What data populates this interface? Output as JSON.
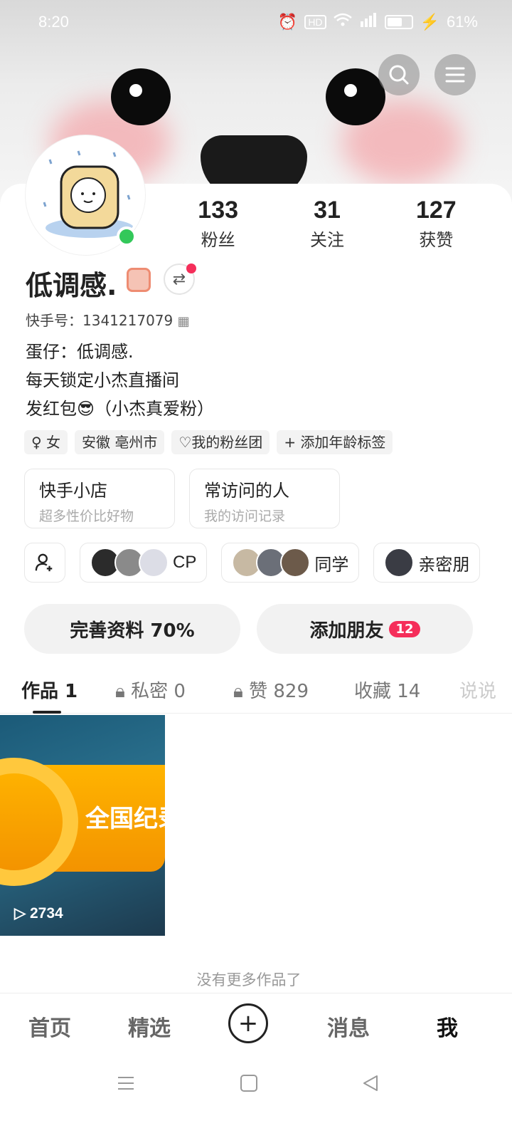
{
  "status_bar": {
    "time": "8:20",
    "battery": "61%"
  },
  "profile": {
    "name": "低调感.",
    "kuaishou_id": "快手号：1341217079",
    "bio": [
      "蛋仔：低调感.",
      "每天锁定小杰直播间",
      "发红包😎（小杰真爱粉）"
    ],
    "stats": [
      {
        "num": "133",
        "label": "粉丝"
      },
      {
        "num": "31",
        "label": "关注"
      },
      {
        "num": "127",
        "label": "获赞"
      }
    ],
    "tags": [
      "女",
      "安徽 亳州市",
      "我的粉丝团",
      "添加年龄标签"
    ]
  },
  "features": [
    {
      "title": "快手小店",
      "sub": "超多性价比好物"
    },
    {
      "title": "常访问的人",
      "sub": "我的访问记录"
    }
  ],
  "friend_groups": [
    {
      "label": "CP"
    },
    {
      "label": "同学"
    },
    {
      "label": "亲密朋"
    }
  ],
  "actions": {
    "complete_profile": "完善资料 70%",
    "add_friends": "添加朋友",
    "add_friends_badge": "12"
  },
  "tabs": [
    {
      "label": "作品 1"
    },
    {
      "label": "私密 0"
    },
    {
      "label": "赞 829"
    },
    {
      "label": "收藏 14"
    },
    {
      "label": "说说"
    }
  ],
  "works": [
    {
      "plays": "2734",
      "title": "全国纪录"
    }
  ],
  "no_more": "没有更多作品了",
  "bottom_nav": {
    "home": "首页",
    "featured": "精选",
    "messages": "消息",
    "me": "我"
  }
}
